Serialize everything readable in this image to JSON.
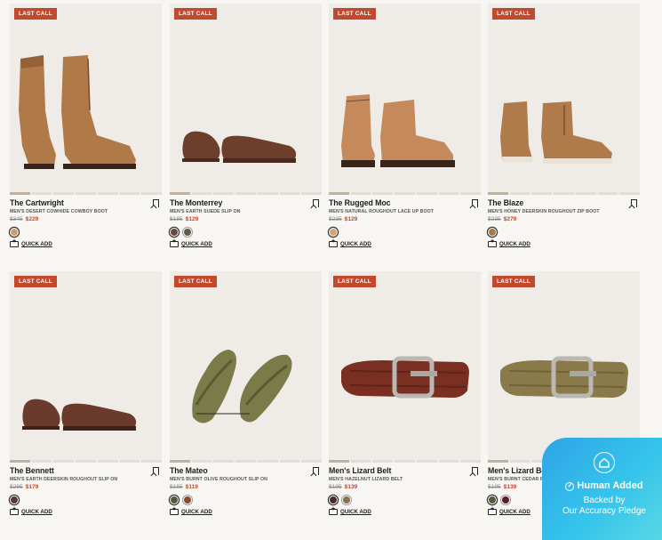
{
  "products": [
    {
      "badge": "LAST CALL",
      "name": "The Cartwright",
      "subtitle": "MEN'S DESERT COWHIDE COWBOY BOOT",
      "old_price": "$345",
      "new_price": "$229",
      "quick_add": "QUICK ADD",
      "image": "cowboy-boot",
      "swatches": [
        "#c99f72"
      ],
      "colors": [
        "#b07a48",
        "#7a4a27"
      ]
    },
    {
      "badge": "LAST CALL",
      "name": "The Monterrey",
      "subtitle": "MEN'S EARTH SUEDE SLIP ON",
      "old_price": "$185",
      "new_price": "$129",
      "quick_add": "QUICK ADD",
      "image": "loafer",
      "swatches": [
        "#6b4a3e",
        "#5d5e45"
      ],
      "colors": [
        "#6e3e2c",
        "#4a2a1e"
      ]
    },
    {
      "badge": "LAST CALL",
      "name": "The Rugged Moc",
      "subtitle": "MEN'S NATURAL ROUGHOUT LACE UP BOOT",
      "old_price": "$235",
      "new_price": "$129",
      "quick_add": "QUICK ADD",
      "image": "lace-boot",
      "swatches": [
        "#d3a379"
      ],
      "colors": [
        "#c58a5b",
        "#3a2418"
      ]
    },
    {
      "badge": "LAST CALL",
      "name": "The Blaze",
      "subtitle": "MEN'S HONEY DEERSKIN ROUGHOUT ZIP BOOT",
      "old_price": "$235",
      "new_price": "$279",
      "quick_add": "QUICK ADD",
      "image": "zip-boot",
      "swatches": [
        "#a8774b"
      ],
      "colors": [
        "#b07b4a",
        "#e9e1d4"
      ]
    },
    {
      "badge": "LAST CALL",
      "name": "The Bennett",
      "subtitle": "MEN'S EARTH DEERSKIN ROUGHOUT SLIP ON",
      "old_price": "$285",
      "new_price": "$179",
      "quick_add": "QUICK ADD",
      "image": "loafer",
      "swatches": [
        "#5a3a30"
      ],
      "colors": [
        "#6a3b2d",
        "#3d2219"
      ]
    },
    {
      "badge": "LAST CALL",
      "name": "The Mateo",
      "subtitle": "MEN'S BURNT OLIVE ROUGHOUT SLIP ON",
      "old_price": "$185",
      "new_price": "$119",
      "quick_add": "QUICK ADD",
      "image": "woven-shoe",
      "swatches": [
        "#56563c",
        "#8c4a2f"
      ],
      "colors": [
        "#7b7b4a",
        "#5a5a34"
      ]
    },
    {
      "badge": "LAST CALL",
      "name": "Men's Lizard Belt",
      "subtitle": "MEN'S HAZELNUT LIZARD BELT",
      "old_price": "$195",
      "new_price": "$139",
      "quick_add": "QUICK ADD",
      "image": "belt",
      "swatches": [
        "#4a2a2a",
        "#84704e"
      ],
      "colors": [
        "#7a2f22",
        "#4e1e16"
      ]
    },
    {
      "badge": "LAST CALL",
      "name": "Men's Lizard Belt",
      "subtitle": "MEN'S BURNT CEDAR RELIEF LIZARD BELT",
      "old_price": "$195",
      "new_price": "$139",
      "quick_add": "QUICK ADD",
      "image": "belt",
      "swatches": [
        "#585a3c",
        "#5a1e24"
      ],
      "colors": [
        "#8a7a4a",
        "#5e5432"
      ]
    }
  ],
  "pledge": {
    "title": "Human Added",
    "line2": "Backed by",
    "line3": "Our Accuracy Pledge",
    "icon": "home-icon"
  }
}
